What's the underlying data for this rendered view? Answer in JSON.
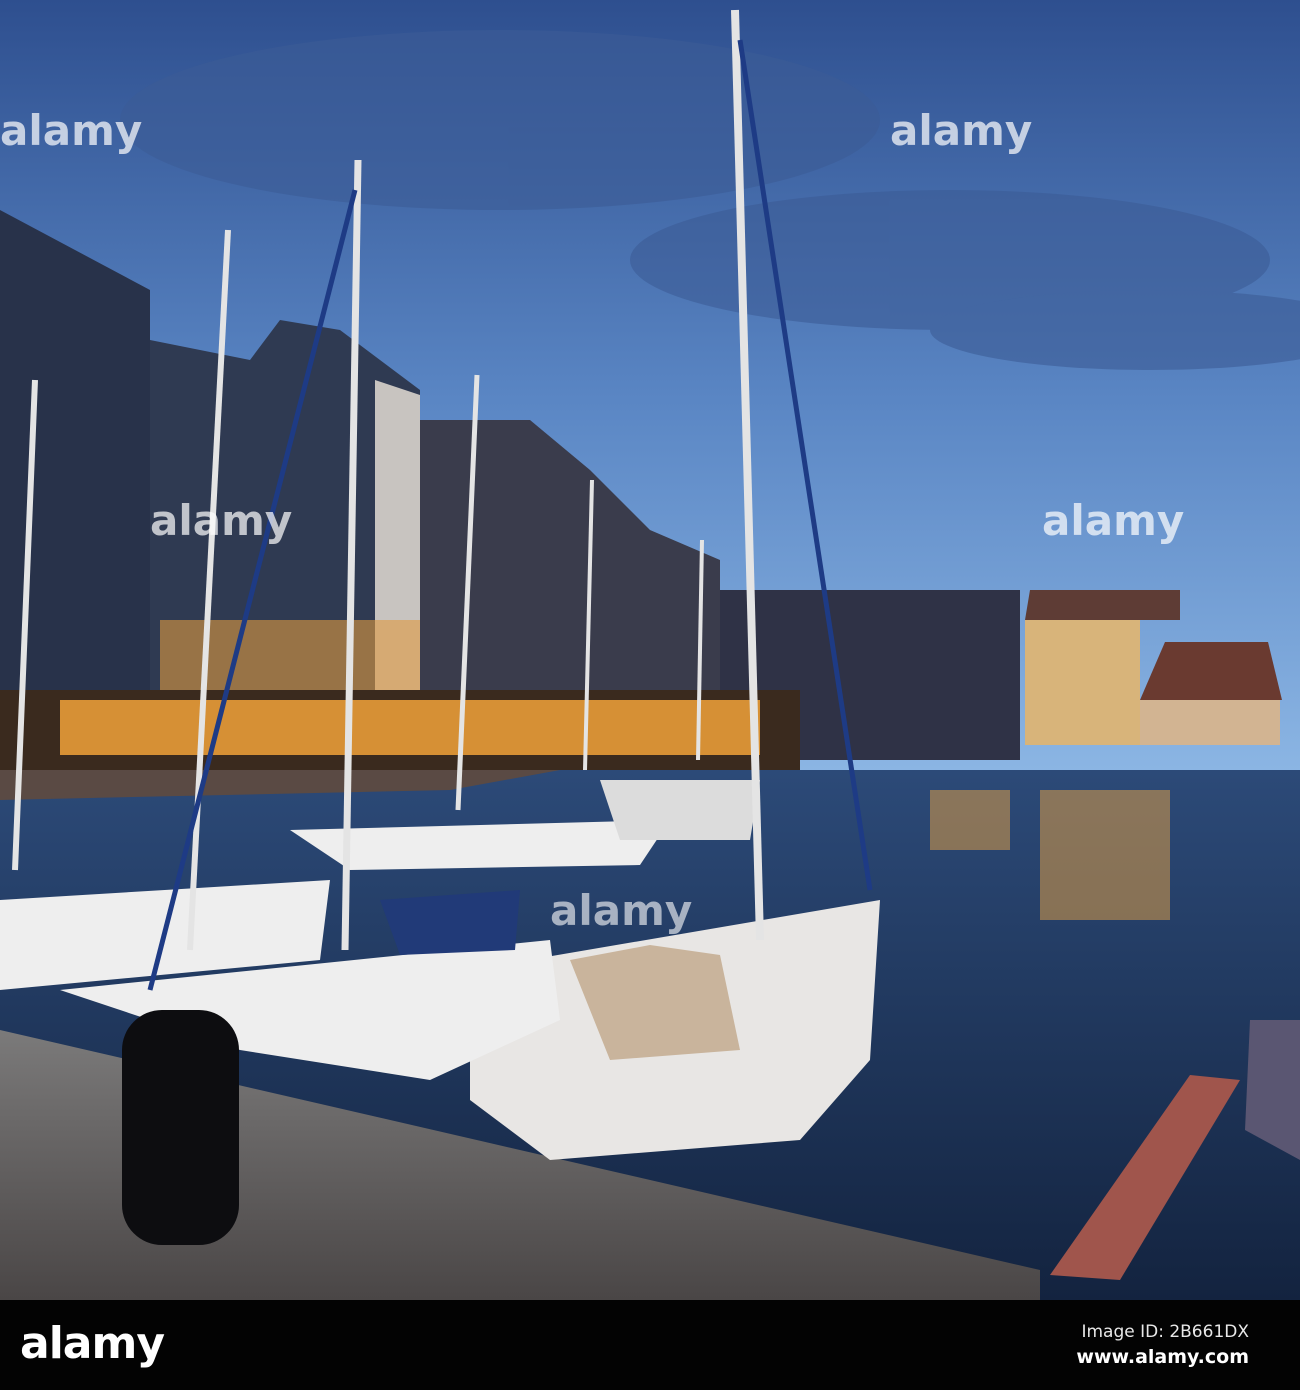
{
  "photo": {
    "subject": "Harbour at dusk with sailboats",
    "watermark": "alamy",
    "colors": {
      "sky_top": "#2e4f8f",
      "sky_bottom": "#7eaee0",
      "water": "#1d3457",
      "lights": "#f2a23a",
      "quay": "#6e6c6c"
    }
  },
  "footer": {
    "logo": "alamy",
    "image_id": "Image ID: 2B661DX",
    "website": "www.alamy.com"
  }
}
